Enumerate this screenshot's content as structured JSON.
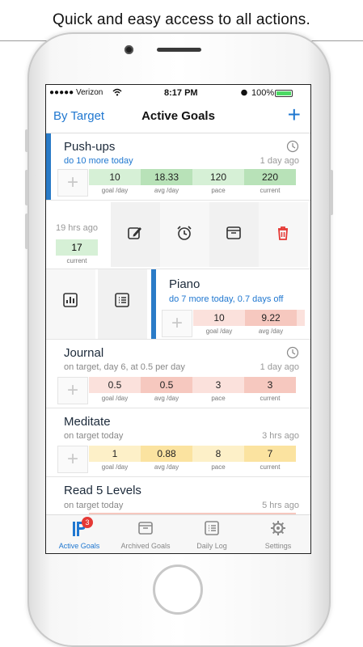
{
  "caption": "Quick and easy access to all actions.",
  "status": {
    "carrier": "●●●●● Verizon",
    "time": "8:17 PM",
    "battery": "100%"
  },
  "nav": {
    "left": "By Target",
    "title": "Active Goals",
    "add": "+"
  },
  "pushups": {
    "title": "Push-ups",
    "sub": "do 10 more today",
    "time": "1 day ago",
    "cells": [
      "10",
      "18.33",
      "120",
      "220"
    ],
    "labels": [
      "goal /day",
      "avg /day",
      "pace",
      "current"
    ]
  },
  "swipe1": {
    "time": "19 hrs ago",
    "value": "17",
    "label": "current"
  },
  "piano": {
    "title": "Piano",
    "sub": "do 7 more today, 0.7 days off",
    "cells": [
      "10",
      "9.22"
    ],
    "labels": [
      "goal /day",
      "avg /day"
    ]
  },
  "journal": {
    "title": "Journal",
    "sub": "on target, day 6, at 0.5 per day",
    "time": "1 day ago",
    "cells": [
      "0.5",
      "0.5",
      "3",
      "3"
    ],
    "labels": [
      "goal /day",
      "avg /day",
      "pace",
      "current"
    ]
  },
  "meditate": {
    "title": "Meditate",
    "sub": "on target today",
    "time": "3 hrs ago",
    "cells": [
      "1",
      "0.88",
      "8",
      "7"
    ],
    "labels": [
      "goal /day",
      "avg /day",
      "pace",
      "current"
    ]
  },
  "read": {
    "title": "Read 5 Levels",
    "sub": "on target today",
    "time": "5 hrs ago"
  },
  "tabs": [
    {
      "label": "Active Goals",
      "badge": "3"
    },
    {
      "label": "Archived Goals"
    },
    {
      "label": "Daily Log"
    },
    {
      "label": "Settings"
    }
  ],
  "colors": {
    "accent": "#1f77d0",
    "green": "#d6f0d6",
    "green_dark": "#b8e2b8",
    "red": "#fbe1dc",
    "red_dark": "#f6c8bf",
    "yellow": "#fdf0c8",
    "yellow_dark": "#fbe3a0",
    "delete": "#e53935"
  }
}
